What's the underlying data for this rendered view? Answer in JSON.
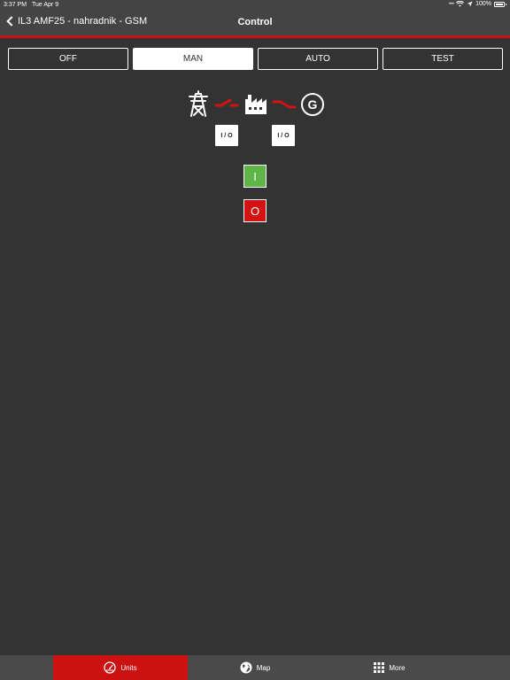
{
  "status": {
    "time": "3:37 PM",
    "date": "Tue Apr 9",
    "battery": "100%"
  },
  "nav": {
    "back_label": "IL3 AMF25 - nahradnik - GSM",
    "title": "Control"
  },
  "modes": [
    {
      "label": "OFF",
      "active": false
    },
    {
      "label": "MAN",
      "active": true
    },
    {
      "label": "AUTO",
      "active": false
    },
    {
      "label": "TEST",
      "active": false
    }
  ],
  "diagram": {
    "icons": [
      "power-tower-icon",
      "mains-breaker-open-icon",
      "factory-icon",
      "generator-breaker-open-icon",
      "generator-icon"
    ],
    "generator_letter": "G",
    "mains_breaker_button": "I / O",
    "generator_breaker_button": "I / O"
  },
  "controls": {
    "start_label": "I",
    "stop_label": "O",
    "start_color": "#5fb548",
    "stop_color": "#d31212"
  },
  "tabs": [
    {
      "label": "Units",
      "icon": "gauge-icon",
      "active": true
    },
    {
      "label": "Map",
      "icon": "globe-icon",
      "active": false
    },
    {
      "label": "More",
      "icon": "grid-icon",
      "active": false
    }
  ],
  "colors": {
    "accent": "#cc1111",
    "background": "#333333",
    "bar": "#444444"
  }
}
